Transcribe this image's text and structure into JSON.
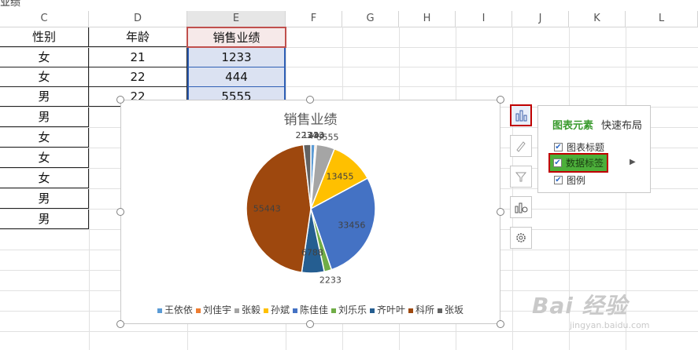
{
  "top_cut_text": "业绩",
  "columns": [
    "C",
    "D",
    "E",
    "F",
    "G",
    "H",
    "I",
    "J",
    "K",
    "L"
  ],
  "table": {
    "headers": {
      "gender": "性别",
      "age": "年龄",
      "sales": "销售业绩"
    },
    "rows": [
      {
        "gender": "女",
        "age": "21",
        "sales": "1233"
      },
      {
        "gender": "女",
        "age": "22",
        "sales": "444"
      },
      {
        "gender": "男",
        "age": "22",
        "sales": "5555"
      },
      {
        "gender": "男"
      },
      {
        "gender": "女"
      },
      {
        "gender": "女"
      },
      {
        "gender": "女"
      },
      {
        "gender": "男"
      },
      {
        "gender": "男"
      }
    ]
  },
  "chart_data": {
    "type": "pie",
    "title": "销售业绩",
    "categories": [
      "王依依",
      "刘佳宇",
      "张毅",
      "孙斌",
      "陈佳佳",
      "刘乐乐",
      "齐叶叶",
      "科所",
      "张坂"
    ],
    "values": [
      1233,
      444,
      5555,
      13455,
      33456,
      2233,
      6788,
      55443,
      2234
    ],
    "colors": [
      "#5b9bd5",
      "#ed7d31",
      "#a5a5a5",
      "#ffc000",
      "#4472c4",
      "#70ad47",
      "#255e91",
      "#9e480e",
      "#636363"
    ],
    "labels": [
      "1233",
      "444",
      "5555",
      "13455",
      "33456",
      "2233",
      "6788",
      "55443",
      "2234"
    ],
    "legend_position": "bottom"
  },
  "side_buttons": [
    {
      "name": "chart-elements-button",
      "icon": "bar-chart-icon",
      "active": true
    },
    {
      "name": "chart-style-button",
      "icon": "brush-icon",
      "active": false
    },
    {
      "name": "chart-filter-button",
      "icon": "filter-icon",
      "active": false
    },
    {
      "name": "chart-type-button",
      "icon": "chart-type-icon",
      "active": false
    },
    {
      "name": "chart-settings-button",
      "icon": "gear-icon",
      "active": false
    }
  ],
  "panel": {
    "tab_elements": "图表元素",
    "tab_layout": "快速布局",
    "items": [
      {
        "label": "图表标题",
        "checked": true
      },
      {
        "label": "数据标签",
        "checked": true
      },
      {
        "label": "图例",
        "checked": true
      }
    ]
  },
  "watermark": {
    "main": "Bai 经验",
    "sub": "jingyan.baidu.com"
  }
}
